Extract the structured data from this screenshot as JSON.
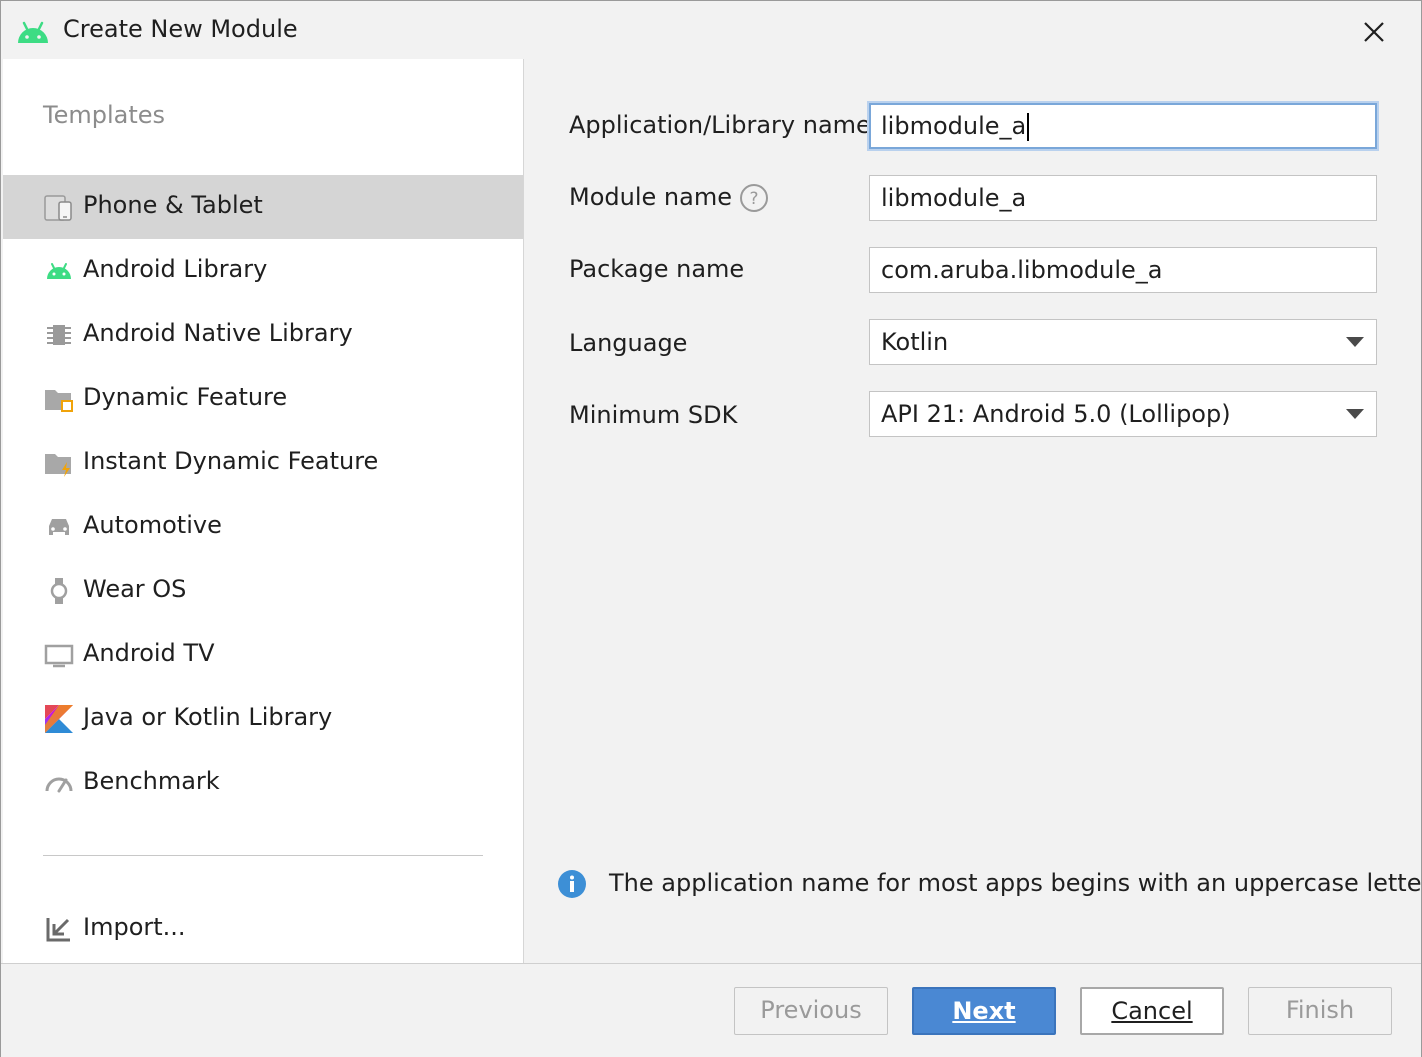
{
  "window": {
    "title": "Create New Module",
    "title_icon": "android-icon",
    "close_icon": "close-icon"
  },
  "templates": {
    "heading": "Templates",
    "items": [
      {
        "label": "Phone & Tablet",
        "icon": "phone-tablet-icon",
        "selected": true
      },
      {
        "label": "Android Library",
        "icon": "android-icon"
      },
      {
        "label": "Android Native Library",
        "icon": "native-library-icon"
      },
      {
        "label": "Dynamic Feature",
        "icon": "dynamic-feature-icon"
      },
      {
        "label": "Instant Dynamic Feature",
        "icon": "instant-dynamic-feature-icon"
      },
      {
        "label": "Automotive",
        "icon": "car-icon"
      },
      {
        "label": "Wear OS",
        "icon": "watch-icon"
      },
      {
        "label": "Android TV",
        "icon": "tv-icon"
      },
      {
        "label": "Java or Kotlin Library",
        "icon": "kotlin-icon"
      },
      {
        "label": "Benchmark",
        "icon": "gauge-icon"
      }
    ],
    "import_label": "Import...",
    "import_icon": "import-icon"
  },
  "form": {
    "app_name_label": "Application/Library name",
    "app_name_value": "libmodule_a",
    "module_name_label": "Module name",
    "module_name_value": "libmodule_a",
    "package_name_label": "Package name",
    "package_name_value": "com.aruba.libmodule_a",
    "language_label": "Language",
    "language_value": "Kotlin",
    "min_sdk_label": "Minimum SDK",
    "min_sdk_value": "API 21: Android 5.0 (Lollipop)"
  },
  "info": {
    "message": "The application name for most apps begins with an uppercase letter"
  },
  "footer": {
    "previous_label": "Previous",
    "next_label": "Next",
    "cancel_label": "Cancel",
    "finish_label": "Finish"
  },
  "colors": {
    "android_green": "#3ddc84",
    "accent_blue": "#4a88d3",
    "selection_gray": "#d5d5d5",
    "info_blue": "#3d8fd6"
  }
}
